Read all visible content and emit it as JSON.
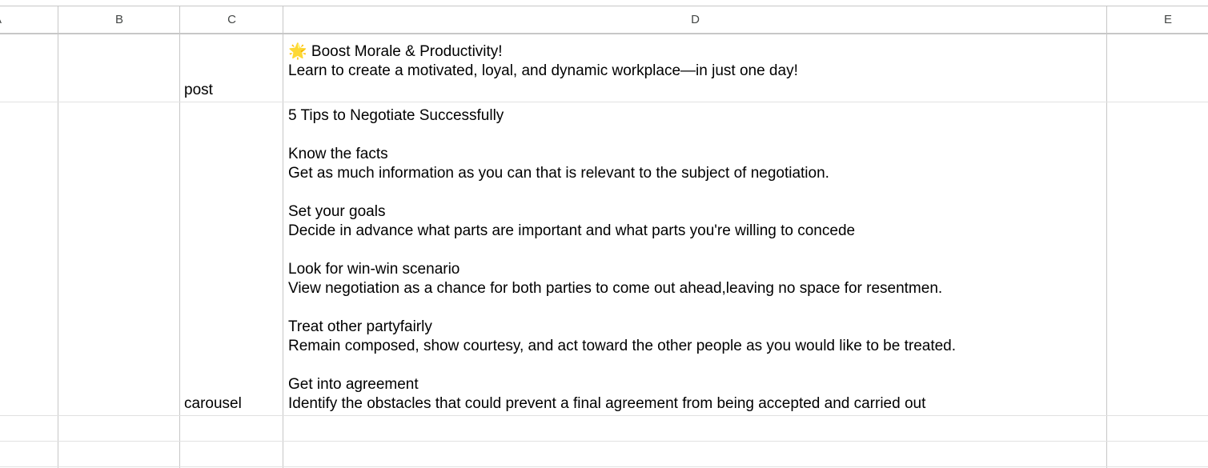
{
  "columns": {
    "a": "A",
    "b": "B",
    "c": "C",
    "d": "D",
    "e": "E"
  },
  "rows": [
    {
      "type": "post",
      "content": "🌟 Boost Morale & Productivity!\nLearn to create a motivated, loyal, and dynamic workplace—in just one day!"
    },
    {
      "type": "carousel",
      "content": "5 Tips to Negotiate Successfully\n\nKnow the facts\nGet as much information as you can that is relevant to the subject of negotiation.\n\nSet your goals\nDecide in advance what parts are important and what parts you're willing to concede\n\nLook for win-win scenario\nView negotiation as a chance for both parties to come out ahead,leaving no space for resentmen.\n\nTreat other partyfairly\nRemain composed, show courtesy, and act toward the other people as you would like to be treated.\n\nGet into agreement\nIdentify the obstacles that could prevent a final agreement from being accepted and carried out"
    }
  ]
}
